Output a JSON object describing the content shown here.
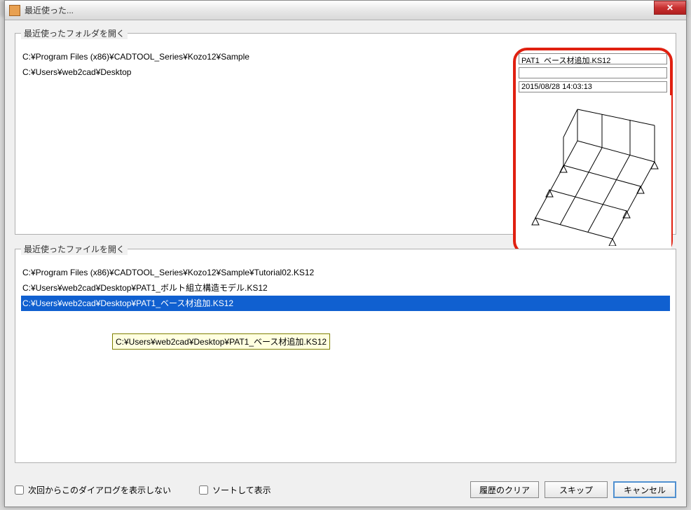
{
  "titlebar": {
    "title": "最近使った..."
  },
  "folders": {
    "legend": "最近使ったフォルダを開く",
    "items": [
      "C:¥Program Files (x86)¥CADTOOL_Series¥Kozo12¥Sample",
      "C:¥Users¥web2cad¥Desktop"
    ]
  },
  "preview": {
    "filename": "PAT1_ベース材追加.KS12",
    "line2": "",
    "timestamp": "2015/08/28 14:03:13"
  },
  "files": {
    "legend": "最近使ったファイルを開く",
    "items": [
      {
        "path": "C:¥Program Files (x86)¥CADTOOL_Series¥Kozo12¥Sample¥Tutorial02.KS12",
        "selected": false
      },
      {
        "path": "C:¥Users¥web2cad¥Desktop¥PAT1_ボルト組立構造モデル.KS12",
        "selected": false
      },
      {
        "path": "C:¥Users¥web2cad¥Desktop¥PAT1_ベース材追加.KS12",
        "selected": true
      }
    ],
    "tooltip": "C:¥Users¥web2cad¥Desktop¥PAT1_ベース材追加.KS12"
  },
  "bottom": {
    "dont_show_label": "次回からこのダイアログを表示しない",
    "sort_label": "ソートして表示",
    "clear_history": "履歴のクリア",
    "skip": "スキップ",
    "cancel": "キャンセル"
  }
}
